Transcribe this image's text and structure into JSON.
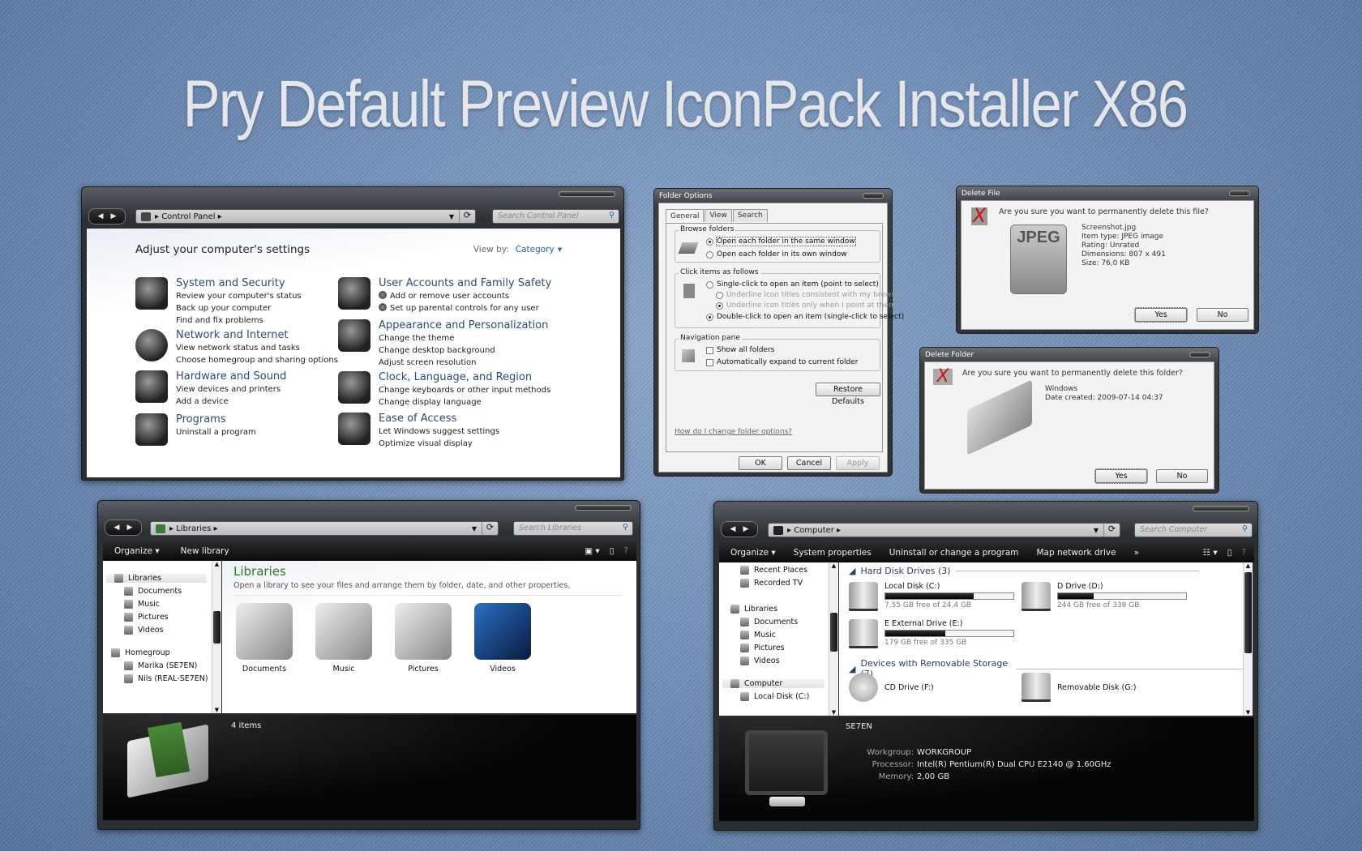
{
  "page_title": "Pry Default Preview IconPack Installer X86",
  "control_panel": {
    "address": "Control Panel",
    "search_placeholder": "Search Control Panel",
    "heading": "Adjust your computer's settings",
    "view_by_label": "View by:",
    "view_by_value": "Category",
    "categories": [
      {
        "title": "System and Security",
        "icon": "system-security-icon",
        "links": [
          "Review your computer's status",
          "Back up your computer",
          "Find and fix problems"
        ]
      },
      {
        "title": "Network and Internet",
        "icon": "network-globe-icon",
        "links": [
          "View network status and tasks",
          "Choose homegroup and sharing options"
        ]
      },
      {
        "title": "Hardware and Sound",
        "icon": "headphones-player-icon",
        "links": [
          "View devices and printers",
          "Add a device"
        ]
      },
      {
        "title": "Programs",
        "icon": "programs-icon",
        "links": [
          "Uninstall a program"
        ]
      },
      {
        "title": "User Accounts and Family Safety",
        "icon": "users-icon",
        "links": [
          "Add or remove user accounts",
          "Set up parental controls for any user"
        ]
      },
      {
        "title": "Appearance and Personalization",
        "icon": "mask-icon",
        "links": [
          "Change the theme",
          "Change desktop background",
          "Adjust screen resolution"
        ]
      },
      {
        "title": "Clock, Language, and Region",
        "icon": "alarm-clock-icon",
        "links": [
          "Change keyboards or other input methods",
          "Change display language"
        ]
      },
      {
        "title": "Ease of Access",
        "icon": "umbrella-icon",
        "links": [
          "Let Windows suggest settings",
          "Optimize visual display"
        ]
      }
    ]
  },
  "folder_options": {
    "title": "Folder Options",
    "tabs": [
      "General",
      "View",
      "Search"
    ],
    "browse_group": "Browse folders",
    "browse_opts": [
      "Open each folder in the same window",
      "Open each folder in its own window"
    ],
    "click_group": "Click items as follows",
    "click_opts": [
      "Single-click to open an item (point to select)",
      "Underline icon titles consistent with my browser",
      "Underline icon titles only when I point at them",
      "Double-click to open an item (single-click to select)"
    ],
    "nav_group": "Navigation pane",
    "nav_opts": [
      "Show all folders",
      "Automatically expand to current folder"
    ],
    "restore": "Restore Defaults",
    "help_link": "How do I change folder options?",
    "ok": "OK",
    "cancel": "Cancel",
    "apply": "Apply"
  },
  "delete_file": {
    "title": "Delete File",
    "question": "Are you sure you want to permanently delete this file?",
    "thumb_label": "JPEG",
    "details": [
      "Screenshot.jpg",
      "Item type: JPEG image",
      "Rating: Unrated",
      "Dimensions: 807 x 491",
      "Size: 76,0 KB"
    ],
    "yes": "Yes",
    "no": "No"
  },
  "delete_folder": {
    "title": "Delete Folder",
    "question": "Are you sure you want to permanently delete this folder?",
    "details": [
      "Windows",
      "Date created: 2009-07-14 04:37"
    ],
    "yes": "Yes",
    "no": "No"
  },
  "libraries": {
    "address": "Libraries",
    "search_placeholder": "Search Libraries",
    "commands": [
      "Organize ▾",
      "New library"
    ],
    "nav": [
      "Libraries",
      "Documents",
      "Music",
      "Pictures",
      "Videos",
      "Homegroup",
      "Marika (SE7EN)",
      "Nils (REAL-SE7EN)"
    ],
    "heading": "Libraries",
    "subheading": "Open a library to see your files and arrange them by folder, date, and other properties.",
    "items": [
      "Documents",
      "Music",
      "Pictures",
      "Videos"
    ],
    "status": "4 items"
  },
  "computer": {
    "address": "Computer",
    "search_placeholder": "Search Computer",
    "commands": [
      "Organize ▾",
      "System properties",
      "Uninstall or change a program",
      "Map network drive",
      "»"
    ],
    "nav": [
      "Recent Places",
      "Recorded TV",
      "Libraries",
      "Documents",
      "Music",
      "Pictures",
      "Videos",
      "Computer",
      "Local Disk (C:)"
    ],
    "section_hdd": "Hard Disk Drives (3)",
    "drives": [
      {
        "name": "Local Disk (C:)",
        "free": "7,55 GB free of 24,4 GB",
        "used_fraction": 0.69
      },
      {
        "name": "D Drive (D:)",
        "free": "244 GB free of 338 GB",
        "used_fraction": 0.28
      },
      {
        "name": "E External Drive (E:)",
        "free": "179 GB free of 335 GB",
        "used_fraction": 0.47
      }
    ],
    "section_removable": "Devices with Removable Storage (7)",
    "removable": [
      "CD Drive (F:)",
      "Removable Disk (G:)"
    ],
    "pc_name": "SE7EN",
    "props": [
      {
        "label": "Workgroup:",
        "value": "WORKGROUP"
      },
      {
        "label": "Processor:",
        "value": "Intel(R) Pentium(R) Dual  CPU  E2140  @ 1.60GHz"
      },
      {
        "label": "Memory:",
        "value": "2,00 GB"
      }
    ]
  }
}
